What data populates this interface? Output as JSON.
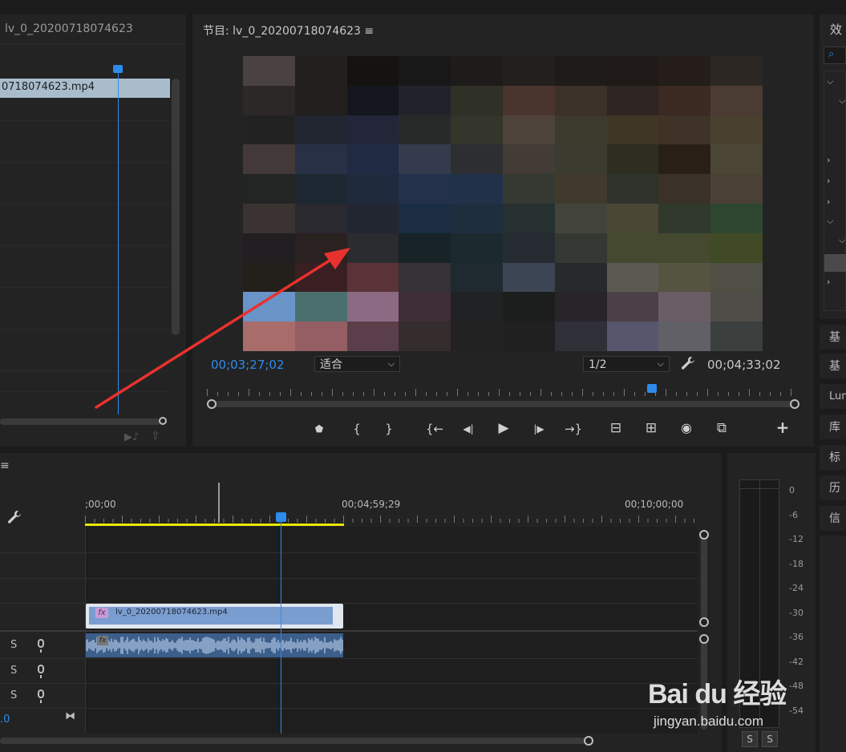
{
  "source_panel": {
    "title": "lv_0_20200718074623",
    "clip_name": "0718074623.mp4"
  },
  "program_monitor": {
    "title": "节目: lv_0_20200718074623 ≡",
    "timecode_current": "00;03;27;02",
    "zoom": "适合",
    "resolution": "1/2",
    "timecode_duration": "00;04;33;02",
    "playhead_fraction": 0.75,
    "transport": {
      "marker": "⬟",
      "mark_in": "{",
      "mark_out": "}",
      "go_to_in": "{←",
      "step_back": "◀|",
      "play": "▶",
      "step_forward": "|▶",
      "go_to_out": "→}",
      "lift": "⊟",
      "extract": "⊞",
      "camera": "◉",
      "compare": "⧉",
      "add": "+"
    }
  },
  "effects_panel": {
    "title": "效",
    "side_tabs": [
      "基",
      "基",
      "Lum",
      "库",
      "标",
      "历",
      "信"
    ]
  },
  "timeline": {
    "menu": "≡",
    "ruler_labels": [
      ";00;00",
      "00;04;59;29",
      "00;10;00;00"
    ],
    "video_clip": "lv_0_20200718074623.mp4",
    "fx_badge": "fx",
    "audio_fx_badge": "fx",
    "track_controls": [
      {
        "solo": "S"
      },
      {
        "solo": "S"
      },
      {
        "solo": "S"
      }
    ],
    "master_value": ".0",
    "playhead_fraction": 0.69
  },
  "audio_meter": {
    "scale": [
      "0",
      "-6",
      "-12",
      "-18",
      "-24",
      "-30",
      "-36",
      "-42",
      "-48",
      "-54"
    ],
    "solo_left": "S",
    "solo_right": "S"
  },
  "watermark": {
    "logo": "Bai du 经验",
    "url": "jingyan.baidu.com"
  },
  "colors": {
    "accent_blue": "#2d8ceb",
    "work_area_yellow": "#e8e800",
    "clip_blue": "#8aa9d6",
    "annotation_arrow": "#e8322e"
  },
  "mosaic_colors": [
    "#4a4240",
    "#22201e",
    "#151212",
    "#191818",
    "#1d1c1a",
    "#221f1c",
    "#1f1b18",
    "#1f1a17",
    "#241d19",
    "#2d2723",
    "#2b2827",
    "#221f1d",
    "#14171d",
    "#22232a",
    "#2f3026",
    "#4a342e",
    "#3b3128",
    "#2e2421",
    "#3a2a22",
    "#4a3c33",
    "#232222",
    "#222630",
    "#232639",
    "#272a29",
    "#34352b",
    "#4d433a",
    "#3c3a2c",
    "#3f3623",
    "#3e3326",
    "#4a4030",
    "#433938",
    "#273044",
    "#1e2b42",
    "#333b4c",
    "#2d2e31",
    "#423b36",
    "#3c3b2f",
    "#2e2d22",
    "#2a1f16",
    "#4a4535",
    "#232524",
    "#1e2833",
    "#1f2a3c",
    "#24314a",
    "#22314a",
    "#343a31",
    "#3f3a2c",
    "#2e332c",
    "#3a3229",
    "#4a4035",
    "#3a3332",
    "#2a2930",
    "#212631",
    "#1a2d42",
    "#1e2e3d",
    "#263030",
    "#42443a",
    "#4a4634",
    "#30392c",
    "#2d4630",
    "#211f22",
    "#2a2121",
    "#2a2c2f",
    "#172326",
    "#1b2a2f",
    "#252b31",
    "#353832",
    "#45492f",
    "#44492f",
    "#404a25",
    "#231f1b",
    "#3a1f22",
    "#5a3338",
    "#353134",
    "#1e2a30",
    "#3c4554",
    "#272a2b",
    "#5b5a52",
    "#545441",
    "#4f4f45",
    "#6894c8",
    "#4a6f6e",
    "#8d6a84",
    "#3f2e35",
    "#202223",
    "#1c1e1e",
    "#28252a",
    "#4c3f47",
    "#6a5d66",
    "#4f4d47",
    "#a86d6a",
    "#955e65",
    "#5a3f4a",
    "#352c2e",
    "#232222",
    "#212020",
    "#2f2f38",
    "#56566c",
    "#606066",
    "#3b3f3d"
  ]
}
